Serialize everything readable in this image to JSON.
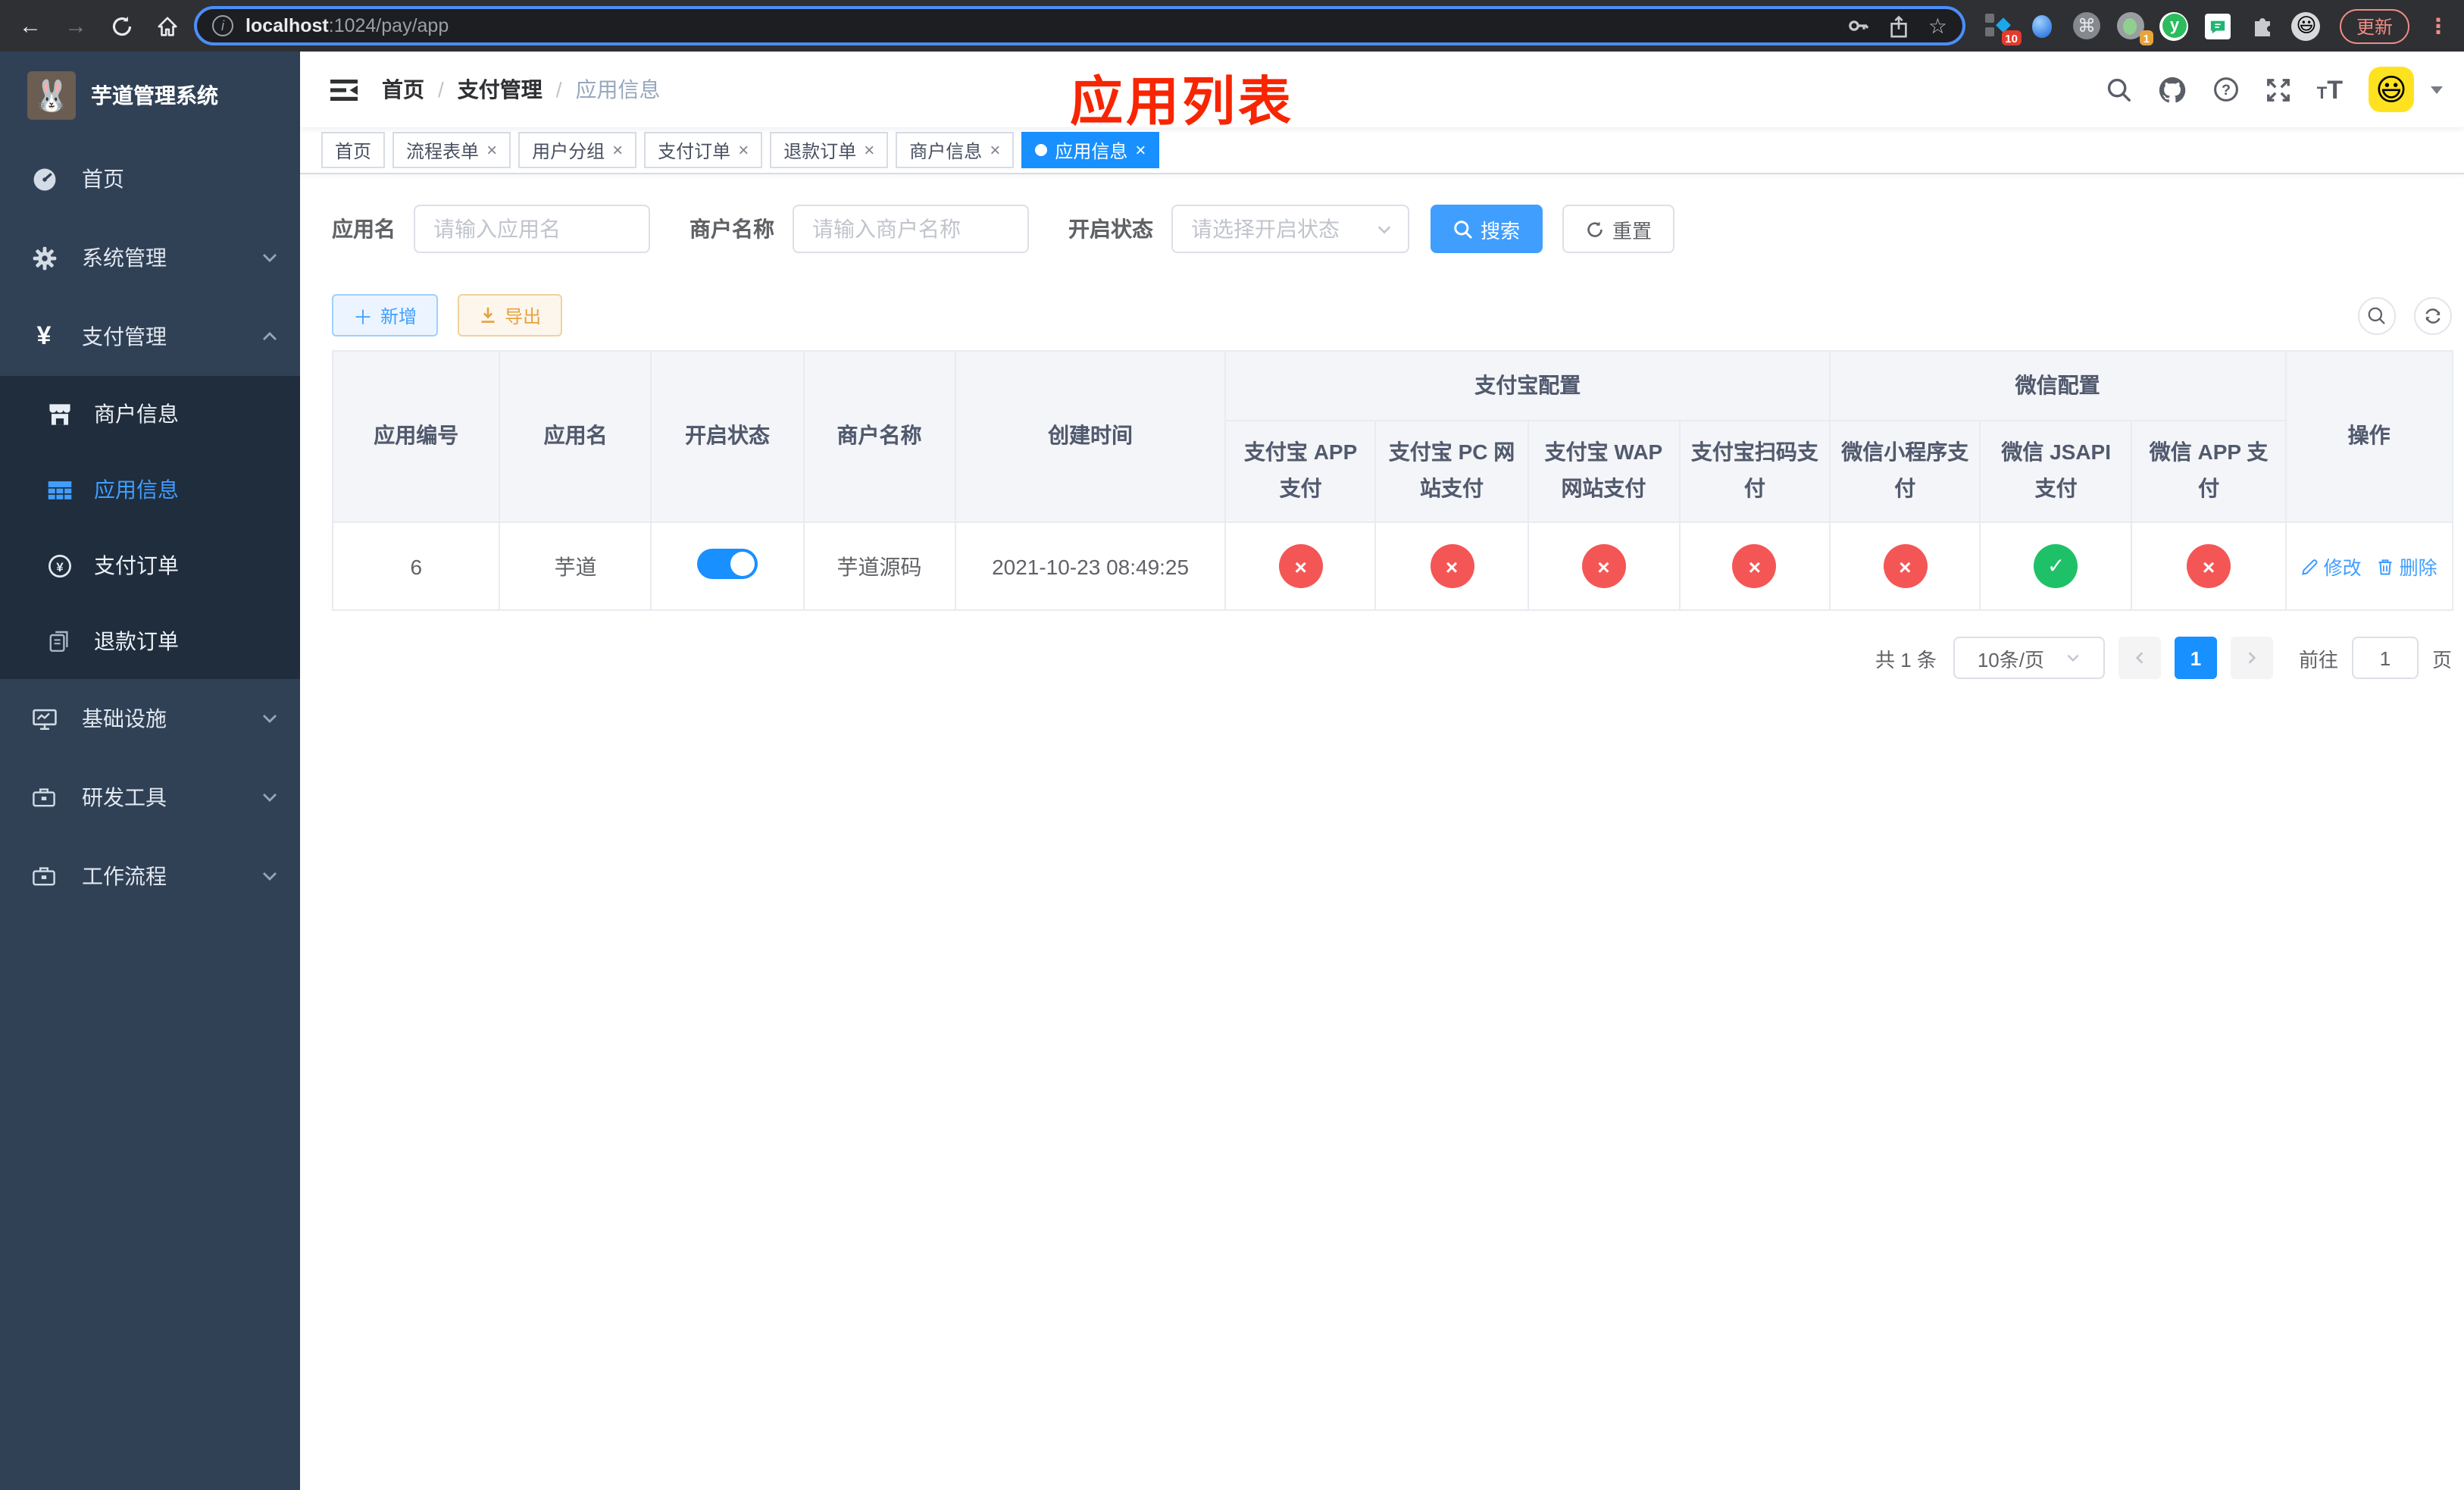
{
  "browser": {
    "url_host": "localhost",
    "url_rest": ":1024/pay/app",
    "update_label": "更新",
    "ext_badge_10": "10",
    "ext_badge_1": "1"
  },
  "sidebar": {
    "title": "芋道管理系统",
    "items": [
      {
        "label": "首页"
      },
      {
        "label": "系统管理"
      },
      {
        "label": "支付管理"
      },
      {
        "label": "商户信息"
      },
      {
        "label": "应用信息"
      },
      {
        "label": "支付订单"
      },
      {
        "label": "退款订单"
      },
      {
        "label": "基础设施"
      },
      {
        "label": "研发工具"
      },
      {
        "label": "工作流程"
      }
    ]
  },
  "header": {
    "breadcrumb": [
      "首页",
      "支付管理",
      "应用信息"
    ],
    "annotation": "应用列表"
  },
  "tabs": [
    {
      "label": "首页"
    },
    {
      "label": "流程表单"
    },
    {
      "label": "用户分组"
    },
    {
      "label": "支付订单"
    },
    {
      "label": "退款订单"
    },
    {
      "label": "商户信息"
    },
    {
      "label": "应用信息"
    }
  ],
  "filters": {
    "app_name_label": "应用名",
    "app_name_placeholder": "请输入应用名",
    "merchant_label": "商户名称",
    "merchant_placeholder": "请输入商户名称",
    "status_label": "开启状态",
    "status_placeholder": "请选择开启状态",
    "search_label": "搜索",
    "reset_label": "重置"
  },
  "toolbar": {
    "add_label": "新增",
    "export_label": "导出"
  },
  "table": {
    "columns": [
      "应用编号",
      "应用名",
      "开启状态",
      "商户名称",
      "创建时间"
    ],
    "group_alipay": "支付宝配置",
    "group_wechat": "微信配置",
    "alipay_columns": [
      "支付宝 APP 支付",
      "支付宝 PC 网站支付",
      "支付宝 WAP 网站支付",
      "支付宝扫码支付"
    ],
    "wechat_columns": [
      "微信小程序支付",
      "微信 JSAPI 支付",
      "微信 APP 支付"
    ],
    "actions_column": "操作",
    "row": {
      "id": "6",
      "name": "芋道",
      "merchant": "芋道源码",
      "created": "2021-10-23 08:49:25",
      "statuses": [
        false,
        false,
        false,
        false,
        false,
        true,
        false
      ],
      "edit_label": "修改",
      "delete_label": "删除"
    }
  },
  "pagination": {
    "total": "共 1 条",
    "page_size": "10条/页",
    "page": "1",
    "goto_label": "前往",
    "goto_value": "1",
    "page_suffix": "页"
  }
}
